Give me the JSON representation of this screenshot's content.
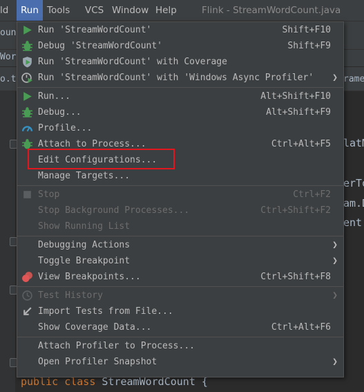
{
  "menubar": {
    "items": [
      {
        "label": "ld"
      },
      {
        "label": "Run"
      },
      {
        "label": "Tools"
      },
      {
        "label": "VCS"
      },
      {
        "label": "Window"
      },
      {
        "label": "Help"
      }
    ],
    "title": "Flink - StreamWordCount.java"
  },
  "background": {
    "frag_ount": "ount",
    "frag_word": "Word",
    "frag_ot": "o.t",
    "frag_ramet": "ramet",
    "frag_latm": "latM",
    "frag_erto": "erTo",
    "frag_amd": "am.D",
    "frag_ent": "ent.",
    "code_kw1": "public",
    "code_kw2": "class",
    "code_name": "StreamWordCount {"
  },
  "menu": {
    "run_streamwordcount": {
      "label": "Run 'StreamWordCount'",
      "shortcut": "Shift+F10"
    },
    "debug_streamwordcount": {
      "label": "Debug 'StreamWordCount'",
      "shortcut": "Shift+F9"
    },
    "run_coverage": {
      "label": "Run 'StreamWordCount' with Coverage"
    },
    "run_async_profiler": {
      "label": "Run 'StreamWordCount' with 'Windows Async Profiler'"
    },
    "run": {
      "label": "Run...",
      "shortcut": "Alt+Shift+F10"
    },
    "debug": {
      "label": "Debug...",
      "shortcut": "Alt+Shift+F9"
    },
    "profile": {
      "label": "Profile..."
    },
    "attach": {
      "label": "Attach to Process...",
      "shortcut": "Ctrl+Alt+F5"
    },
    "edit_config": {
      "label": "Edit Configurations..."
    },
    "manage_targets": {
      "label": "Manage Targets..."
    },
    "stop": {
      "label": "Stop",
      "shortcut": "Ctrl+F2"
    },
    "stop_bg": {
      "label": "Stop Background Processes...",
      "shortcut": "Ctrl+Shift+F2"
    },
    "show_running": {
      "label": "Show Running List"
    },
    "debugging_actions": {
      "label": "Debugging Actions"
    },
    "toggle_breakpoint": {
      "label": "Toggle Breakpoint"
    },
    "view_breakpoints": {
      "label": "View Breakpoints...",
      "shortcut": "Ctrl+Shift+F8"
    },
    "test_history": {
      "label": "Test History"
    },
    "import_tests": {
      "label": "Import Tests from File..."
    },
    "show_coverage": {
      "label": "Show Coverage Data...",
      "shortcut": "Ctrl+Alt+F6"
    },
    "attach_profiler": {
      "label": "Attach Profiler to Process..."
    },
    "open_snapshot": {
      "label": "Open Profiler Snapshot"
    }
  },
  "colors": {
    "accent": "#4b6eaf",
    "run_green": "#499c54",
    "highlight_red": "#e0171f"
  }
}
